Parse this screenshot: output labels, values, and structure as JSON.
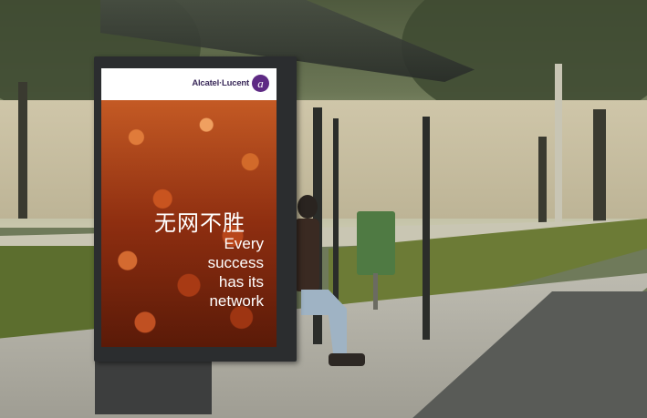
{
  "poster": {
    "brand": "Alcatel·Lucent",
    "logo_glyph": "a",
    "slogan_cn": "无网不胜",
    "slogan_en_lines": [
      "Every",
      "success",
      "has its",
      "network"
    ]
  },
  "colors": {
    "logo_purple": "#5e2a84",
    "poster_orange": "#c45a24",
    "bin_green": "#4f7a43"
  }
}
